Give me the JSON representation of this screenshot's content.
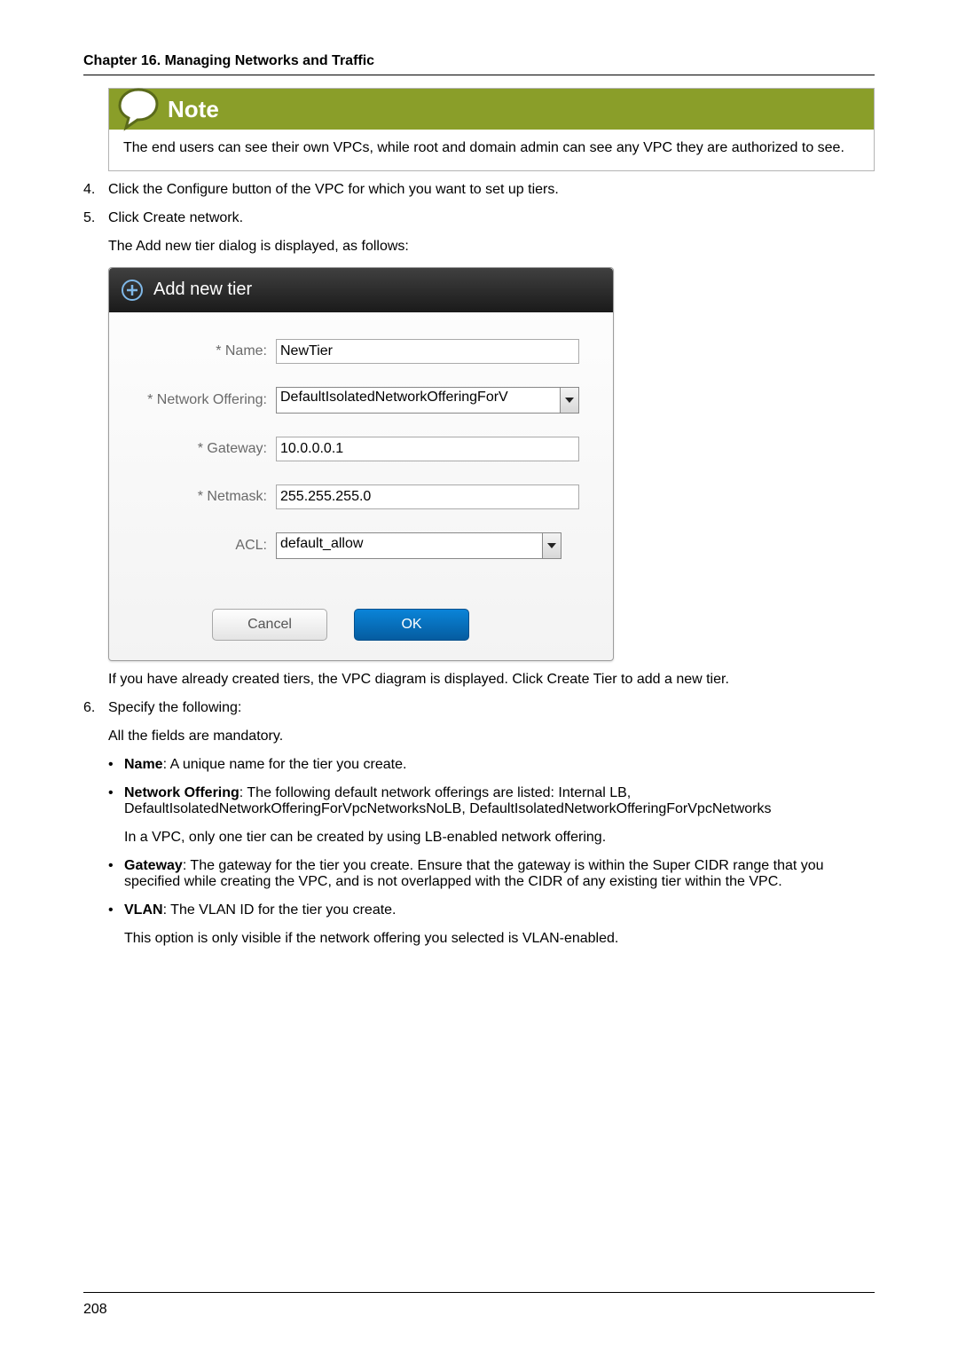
{
  "chapter_heading": "Chapter 16. Managing Networks and Traffic",
  "note": {
    "title": "Note",
    "body": "The end users can see their own VPCs, while root and domain admin can see any VPC they are authorized to see."
  },
  "steps": {
    "4": {
      "num": "4.",
      "text": "Click the Configure button of the VPC for which you want to set up tiers."
    },
    "5": {
      "num": "5.",
      "line1": "Click Create network.",
      "line2": "The Add new tier dialog is displayed, as follows:",
      "after_dialog": "If you have already created tiers, the VPC diagram is displayed. Click Create Tier to add a new tier."
    },
    "6": {
      "num": "6.",
      "line1": "Specify the following:",
      "line2": "All the fields are mandatory.",
      "bullets": {
        "name": {
          "label": "Name",
          "rest": ": A unique name for the tier you create."
        },
        "offering": {
          "label": "Network Offering",
          "rest1": ": The following default network offerings are listed: Internal LB, DefaultIsolatedNetworkOfferingForVpcNetworksNoLB, DefaultIsolatedNetworkOfferingForVpcNetworks",
          "rest2": "In a VPC, only one tier can be created by using LB-enabled network offering."
        },
        "gateway": {
          "label": "Gateway",
          "rest": ": The gateway for the tier you create. Ensure that the gateway is within the Super CIDR range that you specified while creating the VPC, and is not overlapped with the CIDR of any existing tier within the VPC."
        },
        "vlan": {
          "label": "VLAN",
          "rest1": ": The VLAN ID for the tier you create.",
          "rest2": "This option is only visible if the network offering you selected is VLAN-enabled."
        }
      }
    }
  },
  "dialog": {
    "title": "Add new tier",
    "fields": {
      "name": {
        "label": "* Name:",
        "value": "NewTier"
      },
      "offering": {
        "label": "* Network Offering:",
        "value": "DefaultIsolatedNetworkOfferingForV"
      },
      "gateway": {
        "label": "* Gateway:",
        "value": "10.0.0.0.1"
      },
      "netmask": {
        "label": "* Netmask:",
        "value": "255.255.255.0"
      },
      "acl": {
        "label": "ACL:",
        "value": "default_allow"
      }
    },
    "buttons": {
      "cancel": "Cancel",
      "ok": "OK"
    }
  },
  "page_number": "208"
}
